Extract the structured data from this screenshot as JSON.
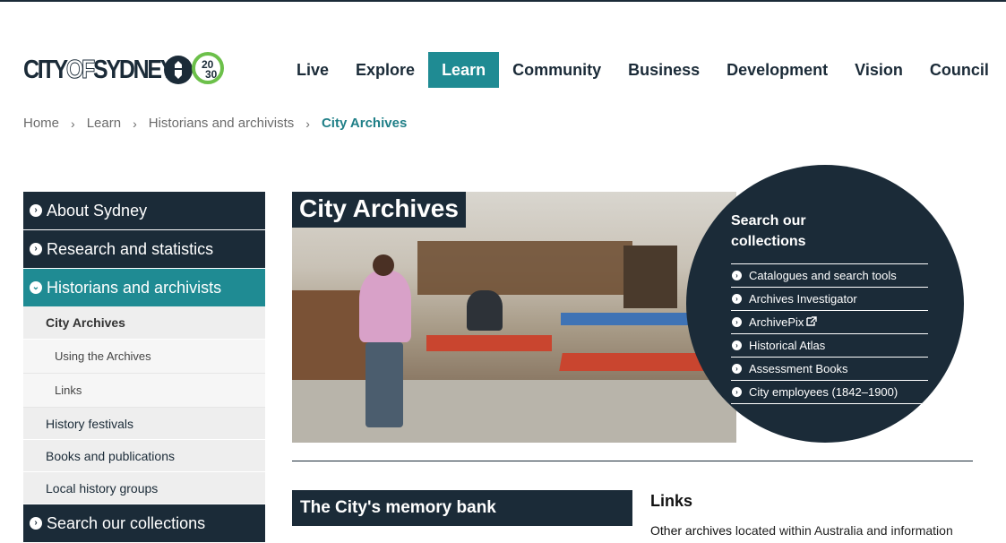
{
  "logo": {
    "pre": "CITY",
    "of": "OF",
    "post": "SYDNEY",
    "badge_top": "20",
    "badge_bottom": "30"
  },
  "nav": [
    {
      "label": "Live"
    },
    {
      "label": "Explore"
    },
    {
      "label": "Learn",
      "active": true
    },
    {
      "label": "Community"
    },
    {
      "label": "Business"
    },
    {
      "label": "Development"
    },
    {
      "label": "Vision"
    },
    {
      "label": "Council"
    }
  ],
  "breadcrumb": [
    "Home",
    "Learn",
    "Historians and archivists",
    "City Archives"
  ],
  "sidebar": {
    "about": "About Sydney",
    "research": "Research and statistics",
    "historians": "Historians and archivists",
    "city_archives": "City Archives",
    "using": "Using the Archives",
    "links": "Links",
    "festivals": "History festivals",
    "books": "Books and publications",
    "local": "Local history groups",
    "search": "Search our collections"
  },
  "hero": {
    "title": "City Archives"
  },
  "search_panel": {
    "title": "Search our collections",
    "items": [
      "Catalogues and search tools",
      "Archives Investigator",
      "ArchivePix",
      "Historical Atlas",
      "Assessment Books",
      "City employees (1842–1900)"
    ]
  },
  "memory_bank": "The City's memory bank",
  "links_section": {
    "title": "Links",
    "link": "Other archives",
    "text": " located within Australia and information"
  },
  "colors": {
    "navy": "#1b2b38",
    "teal": "#1f8b93",
    "green": "#6cc04a"
  },
  "icons": {
    "bullet": "chevron-circle-right-icon",
    "active_bullet": "chevron-circle-down-icon",
    "external": "external-link-icon"
  }
}
